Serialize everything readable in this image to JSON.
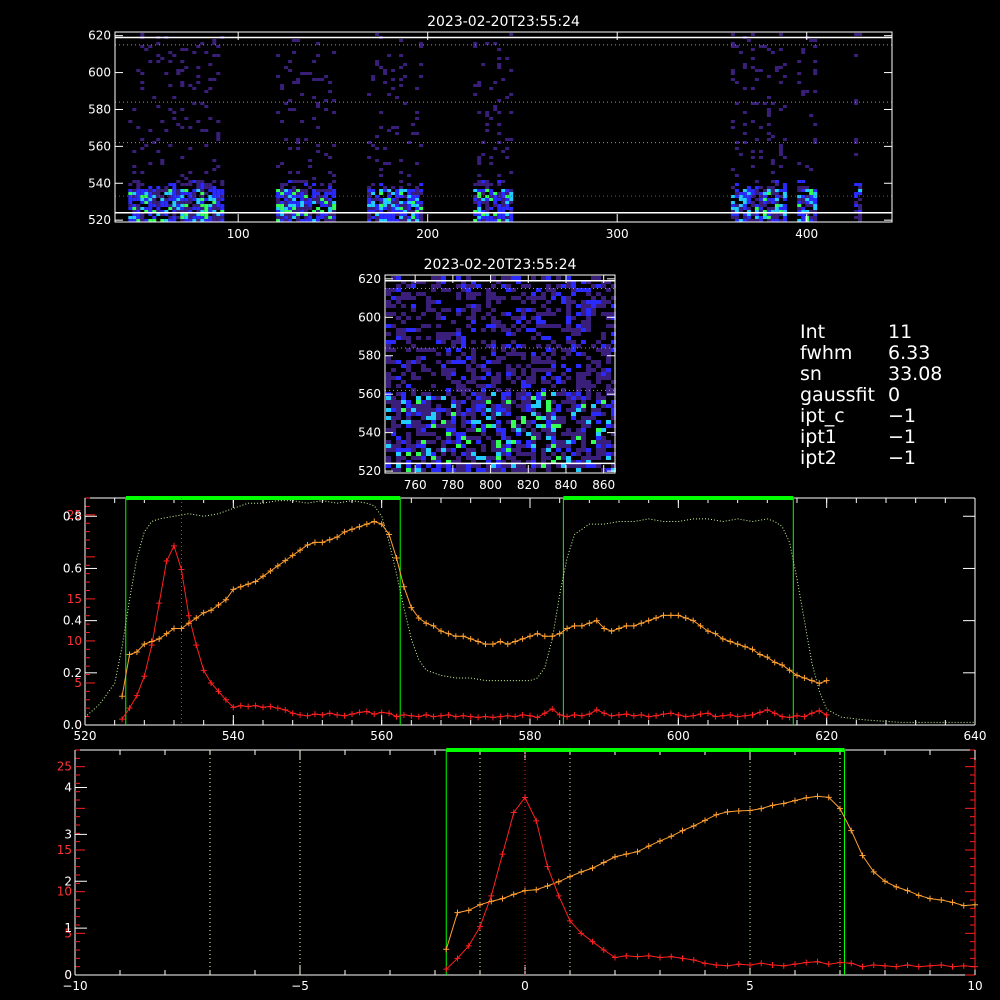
{
  "chart_data": [
    {
      "type": "heatmap",
      "title": "2023-02-20T23:55:24",
      "xlim": [
        35,
        445
      ],
      "ylim": [
        519,
        622
      ],
      "xticks": [
        100,
        200,
        300,
        400
      ],
      "yticks": [
        520,
        540,
        560,
        580,
        600,
        620
      ],
      "bands": [
        [
          42,
          92
        ],
        [
          120,
          150
        ],
        [
          168,
          197
        ],
        [
          224,
          245
        ],
        [
          360,
          388
        ],
        [
          395,
          405
        ],
        [
          425,
          429
        ]
      ],
      "hlines_white": [
        524,
        619
      ],
      "hlines_green": [
        562,
        584,
        615
      ],
      "hline_red": 533
    },
    {
      "type": "heatmap",
      "title": "2023-02-20T23:55:24",
      "xlim": [
        744,
        866
      ],
      "ylim": [
        519,
        622
      ],
      "xticks": [
        760,
        780,
        800,
        820,
        840,
        860
      ],
      "yticks": [
        520,
        540,
        560,
        580,
        600,
        620
      ],
      "hlines_white": [
        524,
        619
      ],
      "hlines_green": [
        562,
        584,
        615
      ]
    },
    {
      "type": "line",
      "xlim": [
        520,
        640
      ],
      "xticks": [
        520,
        540,
        560,
        580,
        600,
        620,
        640
      ],
      "yticks_left_white": [
        0.0,
        0.2,
        0.4,
        0.6,
        0.8
      ],
      "yticks_left_red": [
        0,
        5,
        10,
        15,
        25
      ],
      "ylim_white": [
        0,
        0.87
      ],
      "ylim_red": [
        0,
        27
      ],
      "filter_box_tops": [
        [
          525.5,
          562.5
        ],
        [
          584.5,
          615.5
        ]
      ],
      "red_vline": 533,
      "series": [
        {
          "x": [
            525,
            526,
            527,
            528,
            529,
            530,
            531,
            532,
            533,
            534,
            535,
            536,
            537,
            538,
            539,
            540,
            541,
            542,
            543,
            544,
            545,
            546,
            547,
            548,
            549,
            550,
            551,
            552,
            553,
            554,
            555,
            556,
            557,
            558,
            559,
            560,
            561,
            562,
            563,
            564,
            565,
            566,
            567,
            568,
            569,
            570,
            571,
            572,
            573,
            574,
            575,
            576,
            577,
            578,
            579,
            580,
            581,
            582,
            583,
            584,
            585,
            586,
            587,
            588,
            589,
            590,
            591,
            592,
            593,
            594,
            595,
            596,
            597,
            598,
            599,
            600,
            601,
            602,
            603,
            604,
            605,
            606,
            607,
            608,
            609,
            610,
            611,
            612,
            613,
            614,
            615,
            616,
            617,
            618,
            619,
            620
          ],
          "y": [
            0.7,
            2.0,
            3.5,
            5.8,
            9.5,
            14.5,
            19.5,
            21.3,
            18.5,
            13.0,
            9.5,
            6.5,
            5.0,
            4.0,
            3.0,
            2.1,
            2.3,
            2.2,
            2.3,
            2.1,
            2.2,
            2.0,
            1.8,
            1.4,
            1.2,
            1.1,
            1.3,
            1.2,
            1.4,
            1.2,
            1.1,
            1.3,
            1.5,
            1.6,
            1.3,
            1.5,
            1.4,
            1.0,
            1.2,
            1.1,
            1.0,
            1.2,
            1.0,
            1.1,
            1.2,
            1.0,
            1.1,
            1.0,
            0.9,
            1.0,
            0.9,
            1.0,
            1.1,
            1.0,
            1.2,
            1.1,
            0.9,
            1.4,
            1.9,
            1.2,
            1.0,
            1.2,
            1.1,
            1.3,
            1.8,
            1.4,
            1.1,
            1.2,
            1.3,
            1.1,
            1.2,
            1.0,
            1.1,
            1.3,
            1.4,
            1.2,
            1.0,
            1.1,
            1.3,
            1.4,
            1.0,
            1.1,
            1.2,
            1.0,
            1.1,
            1.2,
            1.5,
            1.8,
            1.4,
            1.0,
            0.9,
            1.1,
            1.0,
            1.4,
            1.7,
            1.2
          ]
        },
        {
          "x": [
            525,
            526,
            527,
            528,
            529,
            530,
            531,
            532,
            533,
            534,
            535,
            536,
            537,
            538,
            539,
            540,
            541,
            542,
            543,
            544,
            545,
            546,
            547,
            548,
            549,
            550,
            551,
            552,
            553,
            554,
            555,
            556,
            557,
            558,
            559,
            560,
            561,
            562,
            563,
            564,
            565,
            566,
            567,
            568,
            569,
            570,
            571,
            572,
            573,
            574,
            575,
            576,
            577,
            578,
            579,
            580,
            581,
            582,
            583,
            584,
            585,
            586,
            587,
            588,
            589,
            590,
            591,
            592,
            593,
            594,
            595,
            596,
            597,
            598,
            599,
            600,
            601,
            602,
            603,
            604,
            605,
            606,
            607,
            608,
            609,
            610,
            611,
            612,
            613,
            614,
            615,
            616,
            617,
            618,
            619,
            620
          ],
          "y": [
            0.11,
            0.27,
            0.28,
            0.31,
            0.32,
            0.33,
            0.35,
            0.37,
            0.37,
            0.39,
            0.41,
            0.43,
            0.44,
            0.46,
            0.48,
            0.52,
            0.53,
            0.54,
            0.55,
            0.57,
            0.59,
            0.61,
            0.63,
            0.65,
            0.67,
            0.69,
            0.7,
            0.7,
            0.71,
            0.72,
            0.74,
            0.75,
            0.76,
            0.77,
            0.78,
            0.77,
            0.73,
            0.64,
            0.53,
            0.45,
            0.41,
            0.39,
            0.38,
            0.36,
            0.35,
            0.34,
            0.34,
            0.33,
            0.32,
            0.31,
            0.31,
            0.32,
            0.31,
            0.32,
            0.33,
            0.34,
            0.35,
            0.34,
            0.34,
            0.35,
            0.37,
            0.38,
            0.38,
            0.39,
            0.4,
            0.37,
            0.36,
            0.37,
            0.38,
            0.38,
            0.39,
            0.4,
            0.41,
            0.42,
            0.42,
            0.42,
            0.41,
            0.4,
            0.38,
            0.36,
            0.35,
            0.33,
            0.32,
            0.31,
            0.3,
            0.29,
            0.27,
            0.26,
            0.24,
            0.23,
            0.21,
            0.19,
            0.18,
            0.17,
            0.16,
            0.17
          ]
        },
        {
          "x": [
            520,
            522,
            524,
            525,
            526,
            527,
            528,
            529,
            530,
            532,
            534,
            536,
            538,
            540,
            542,
            544,
            546,
            548,
            550,
            552,
            554,
            556,
            558,
            559,
            560,
            561,
            562,
            563,
            564,
            565,
            566,
            568,
            570,
            572,
            574,
            576,
            578,
            580,
            581,
            582,
            583,
            584,
            585,
            586,
            588,
            590,
            592,
            594,
            596,
            598,
            600,
            602,
            604,
            606,
            608,
            610,
            612,
            613,
            614,
            615,
            616,
            617,
            618,
            619,
            620,
            622,
            625,
            630,
            635,
            640
          ],
          "y": [
            0.03,
            0.08,
            0.16,
            0.3,
            0.48,
            0.64,
            0.74,
            0.78,
            0.79,
            0.8,
            0.81,
            0.8,
            0.81,
            0.83,
            0.85,
            0.85,
            0.86,
            0.86,
            0.85,
            0.86,
            0.85,
            0.86,
            0.85,
            0.84,
            0.8,
            0.7,
            0.58,
            0.45,
            0.33,
            0.25,
            0.21,
            0.19,
            0.18,
            0.18,
            0.17,
            0.17,
            0.17,
            0.17,
            0.18,
            0.22,
            0.33,
            0.5,
            0.64,
            0.73,
            0.77,
            0.77,
            0.78,
            0.78,
            0.79,
            0.78,
            0.78,
            0.79,
            0.79,
            0.78,
            0.79,
            0.78,
            0.79,
            0.78,
            0.76,
            0.7,
            0.56,
            0.4,
            0.24,
            0.13,
            0.06,
            0.03,
            0.02,
            0.01,
            0.01,
            0.01
          ]
        }
      ]
    },
    {
      "type": "line",
      "xlim": [
        -10,
        10
      ],
      "xticks": [
        -10,
        -5,
        0,
        5,
        10
      ],
      "yticks_left_white": [
        0,
        1,
        2,
        3,
        4
      ],
      "yticks_left_red": [
        0,
        5,
        10,
        15,
        25
      ],
      "ylim_white": [
        0,
        4.8
      ],
      "ylim_red": [
        0,
        27
      ],
      "filter_box": [
        -1.75,
        7.1
      ],
      "vlines_white": [
        -7,
        -5,
        -1,
        1,
        5,
        7
      ],
      "red_vline": 0,
      "series": [
        {
          "x": [
            -1.75,
            -1.5,
            -1.25,
            -1.0,
            -0.75,
            -0.5,
            -0.25,
            0.0,
            0.25,
            0.5,
            0.75,
            1.0,
            1.25,
            1.5,
            1.75,
            2.0,
            2.25,
            2.5,
            2.75,
            3.0,
            3.25,
            3.5,
            3.75,
            4.0,
            4.25,
            4.5,
            4.75,
            5.0,
            5.25,
            5.5,
            5.75,
            6.0,
            6.25,
            6.5,
            6.75,
            7.0,
            7.25,
            7.5,
            7.75,
            8.0,
            8.25,
            8.5,
            8.75,
            9.0,
            9.25,
            9.5,
            9.75,
            10.0
          ],
          "y": [
            0.7,
            2.0,
            3.5,
            5.8,
            9.5,
            14.5,
            19.5,
            21.3,
            18.5,
            13.0,
            9.5,
            6.5,
            5.0,
            4.0,
            3.0,
            2.1,
            2.3,
            2.2,
            2.3,
            2.1,
            2.2,
            2.0,
            1.8,
            1.4,
            1.2,
            1.1,
            1.3,
            1.2,
            1.4,
            1.2,
            1.1,
            1.3,
            1.5,
            1.6,
            1.3,
            1.5,
            1.4,
            1.0,
            1.2,
            1.1,
            1.0,
            1.2,
            1.0,
            1.1,
            1.2,
            1.0,
            1.1,
            1.0
          ]
        },
        {
          "x": [
            -1.75,
            -1.5,
            -1.25,
            -1.0,
            -0.75,
            -0.5,
            -0.25,
            0.0,
            0.25,
            0.5,
            0.75,
            1.0,
            1.25,
            1.5,
            1.75,
            2.0,
            2.25,
            2.5,
            2.75,
            3.0,
            3.25,
            3.5,
            3.75,
            4.0,
            4.25,
            4.5,
            4.75,
            5.0,
            5.25,
            5.5,
            5.75,
            6.0,
            6.25,
            6.5,
            6.75,
            7.0,
            7.25,
            7.5,
            7.75,
            8.0,
            8.25,
            8.5,
            8.75,
            9.0,
            9.25,
            9.5,
            9.75,
            10.0
          ],
          "y": [
            0.55,
            1.33,
            1.38,
            1.5,
            1.57,
            1.63,
            1.72,
            1.8,
            1.82,
            1.9,
            1.99,
            2.1,
            2.2,
            2.28,
            2.4,
            2.52,
            2.58,
            2.63,
            2.75,
            2.86,
            2.96,
            3.08,
            3.18,
            3.3,
            3.42,
            3.48,
            3.5,
            3.51,
            3.55,
            3.62,
            3.66,
            3.72,
            3.78,
            3.81,
            3.79,
            3.55,
            3.08,
            2.55,
            2.2,
            2.0,
            1.88,
            1.8,
            1.7,
            1.63,
            1.6,
            1.55,
            1.48,
            1.5
          ]
        }
      ]
    }
  ],
  "info_panel": {
    "int_label": "Int",
    "int_value": "11",
    "fwhm_label": "fwhm",
    "fwhm_value": "6.33",
    "sn_label": "sn",
    "sn_value": "33.08",
    "gaussfit_label": "gaussfit",
    "gaussfit_value": "0",
    "ipt_c_label": "ipt_c",
    "ipt_c_value": "−1",
    "ipt1_label": "ipt1",
    "ipt1_value": "−1",
    "ipt2_label": "ipt2",
    "ipt2_value": "−1"
  },
  "colors": {
    "orange": "#ffa030",
    "red": "#ff2020",
    "green": "#00ff00",
    "light_green": "#ccff99",
    "axis": "#ffffff",
    "heat_low": "#3a1f7a",
    "heat_mid": "#2a2aff",
    "heat_high": "#22ccff",
    "heat_peak": "#33ff55"
  }
}
